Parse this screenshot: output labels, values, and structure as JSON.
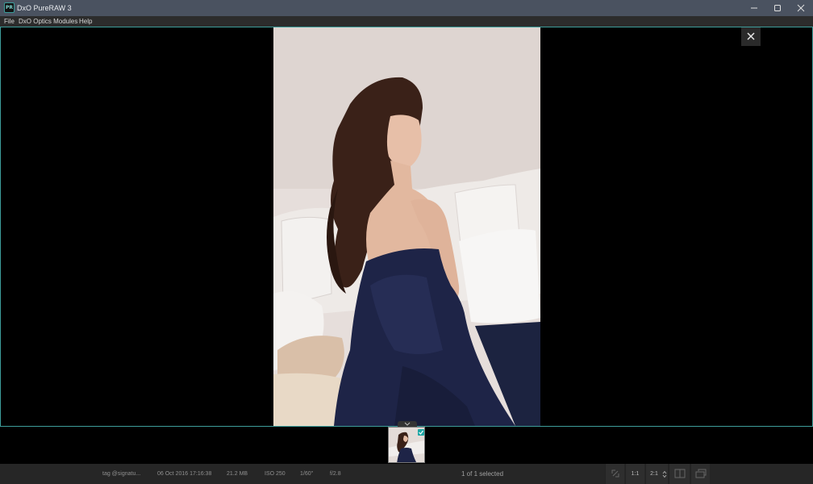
{
  "window": {
    "title": "DxO PureRAW 3",
    "app_icon_text": "PR",
    "minimize_label": "minimize",
    "maximize_label": "maximize",
    "close_label": "close"
  },
  "menu": {
    "items": [
      "File",
      "DxO Optics Modules",
      "Help"
    ]
  },
  "viewer": {
    "accent_color": "#3d9d9a",
    "close_icon": "close-icon"
  },
  "filmstrip": {
    "thumbnail_selected": true,
    "collapse_icon": "chevron-down-icon"
  },
  "status": {
    "filename": "tag @signatu...",
    "date": "06 Oct 2016 17:16:38",
    "size": "21.2 MB",
    "iso": "ISO 250",
    "shutter": "1/60\"",
    "aperture": "f/2.8",
    "selection": "1 of 1 selected",
    "zoom_fit": "1:1",
    "zoom_level": "2:1"
  }
}
